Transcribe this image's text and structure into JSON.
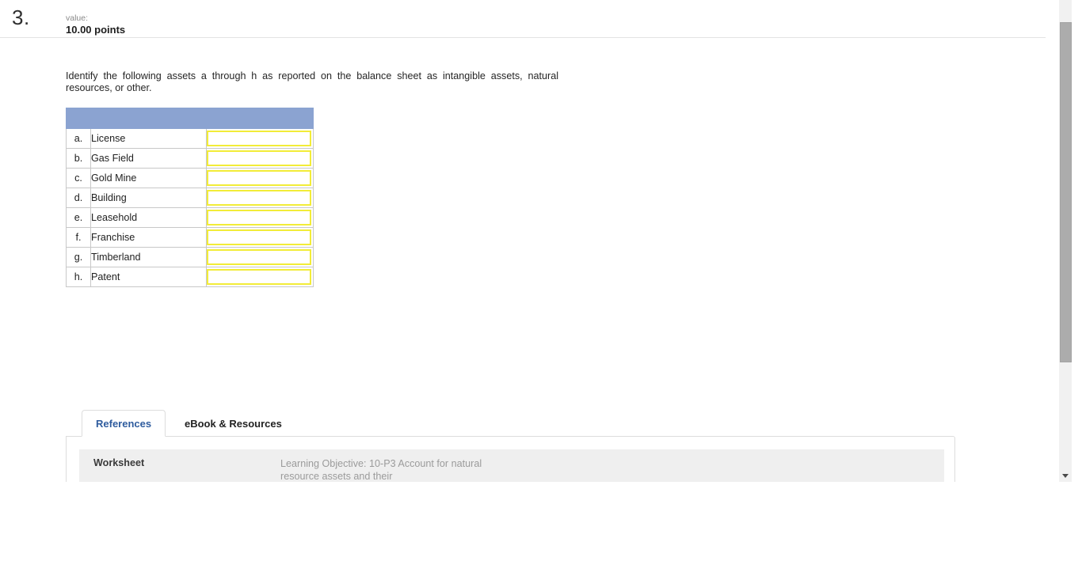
{
  "question": {
    "number": "3.",
    "value_label": "value:",
    "points": "10.00 points",
    "prompt": "Identify the following assets a through h as reported on the balance sheet as intangible assets, natural resources, or other."
  },
  "answer_table": {
    "header_blank": "",
    "rows": [
      {
        "letter": "a.",
        "asset": "License",
        "answer": "",
        "placeholder": ""
      },
      {
        "letter": "b.",
        "asset": "Gas Field",
        "answer": "",
        "placeholder": ""
      },
      {
        "letter": "c.",
        "asset": "Gold Mine",
        "answer": "",
        "placeholder": ""
      },
      {
        "letter": "d.",
        "asset": "Building",
        "answer": "",
        "placeholder": ""
      },
      {
        "letter": "e.",
        "asset": "Leasehold",
        "answer": "",
        "placeholder": ""
      },
      {
        "letter": "f.",
        "asset": "Franchise",
        "answer": "",
        "placeholder": ""
      },
      {
        "letter": "g.",
        "asset": "Timberland",
        "answer": "",
        "placeholder": ""
      },
      {
        "letter": "h.",
        "asset": "Patent",
        "answer": "",
        "placeholder": ""
      }
    ]
  },
  "tabs": [
    {
      "label": "References",
      "active": true
    },
    {
      "label": "eBook & Resources",
      "active": false
    }
  ],
  "worksheet": {
    "label": "Worksheet",
    "objective": "Learning Objective: 10-P3 Account for natural resource assets and their"
  },
  "scrollbar": {
    "down_arrow_icon": "chevron-down-icon"
  },
  "colors": {
    "table_header_blue": "#8ba3d1",
    "input_border_yellow": "#f2ec38",
    "active_tab_text": "#2f5c9e",
    "worksheet_row_bg": "#efefef",
    "scroll_thumb": "#acacac"
  }
}
